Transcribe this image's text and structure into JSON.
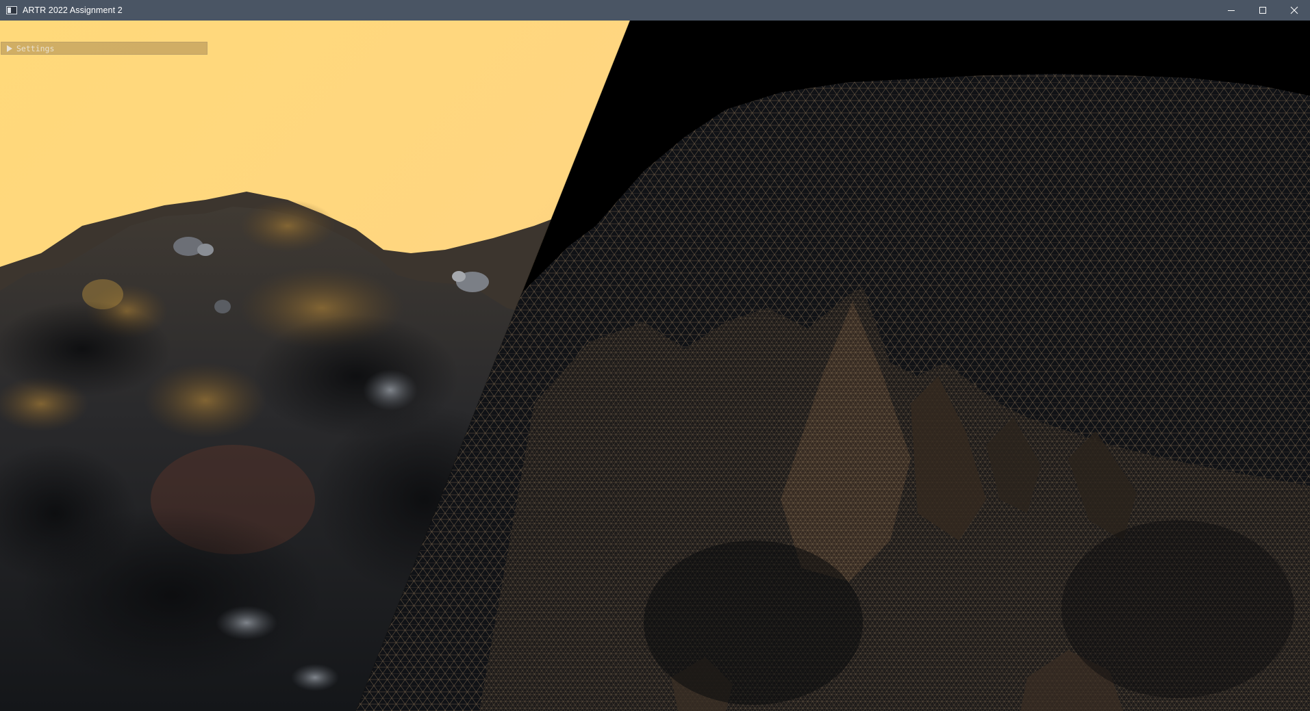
{
  "window": {
    "title": "ARTR 2022 Assignment 2",
    "icon": "app-window-icon",
    "controls": [
      "minimize-icon",
      "maximize-icon",
      "close-icon"
    ]
  },
  "settings_panel": {
    "title": "Settings",
    "state": "collapsed",
    "arrow_icon": "triangle-right-icon"
  },
  "scene": {
    "left_half": "shaded terrain",
    "right_half": "wireframe terrain",
    "colors": {
      "sky_top": "#f2c06c",
      "sky_bottom": "#ffe08a",
      "rock_dark": "#1c1f24",
      "rock_mid": "#3a3a38",
      "moss": "#7a5a2a",
      "wire": "#b5936a",
      "void": "#000000"
    }
  }
}
